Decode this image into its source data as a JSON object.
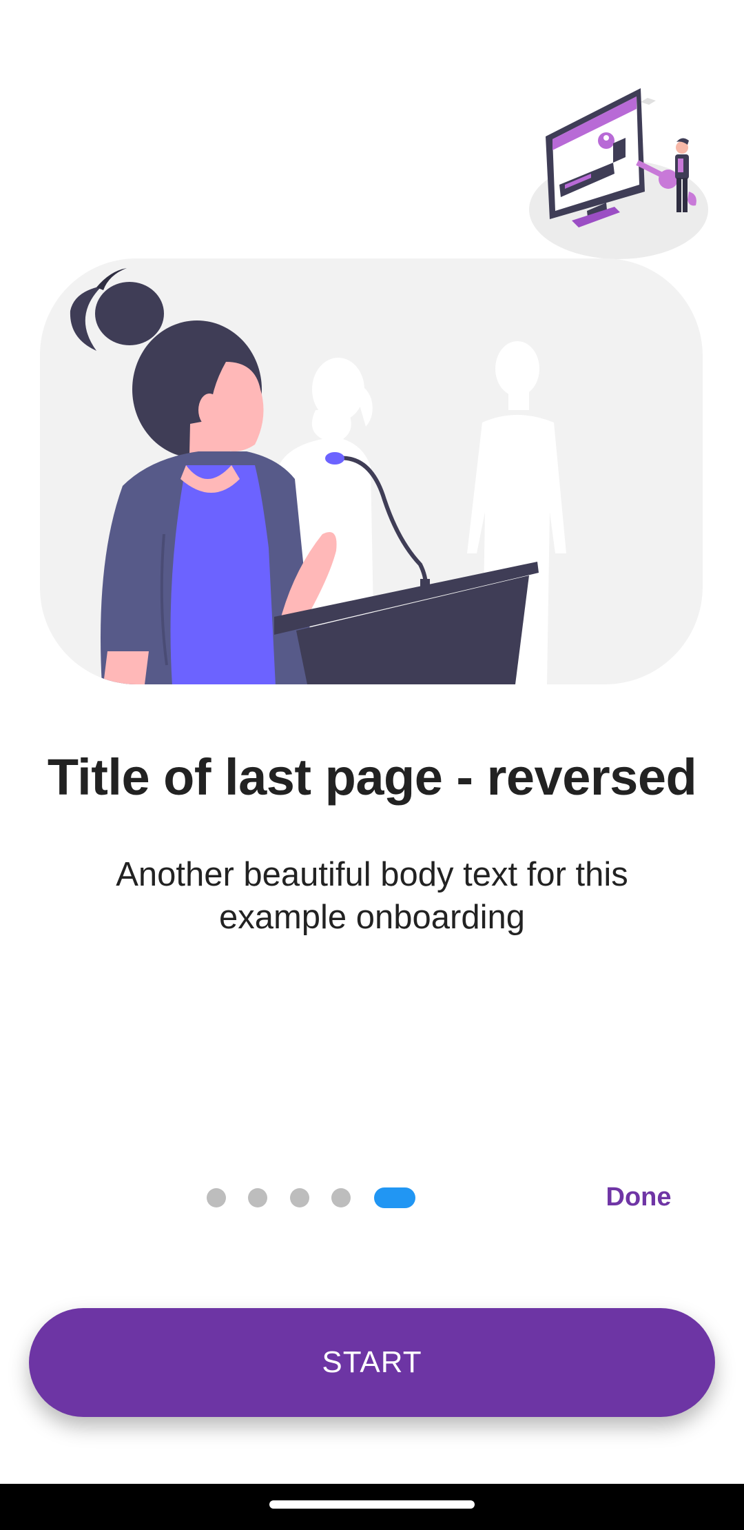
{
  "onboarding": {
    "title": "Title of last page - reversed",
    "body": "Another beautiful body text for this example onboarding",
    "page_indicator": {
      "total": 5,
      "current": 5
    },
    "done_label": "Done",
    "start_label": "START"
  },
  "illustrations": {
    "corner": "login-key-illustration",
    "main": "woman-at-podium-illustration"
  },
  "colors": {
    "primary": "#6d35a4",
    "indicator_active": "#2196f3",
    "indicator_inactive": "#bdbdbd",
    "text": "#222222",
    "accent_figure": "#6c63ff"
  }
}
